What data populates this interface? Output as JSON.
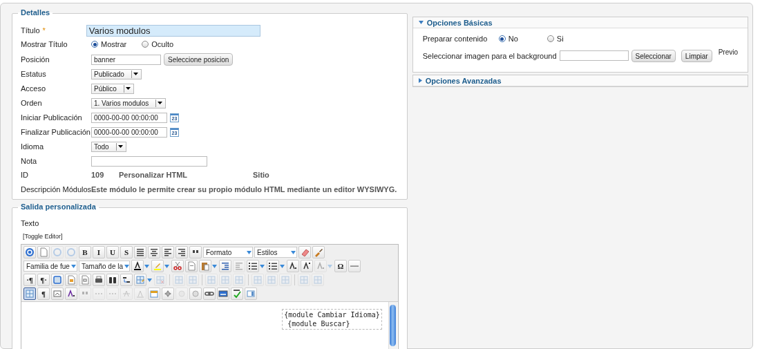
{
  "details": {
    "legend": "Detalles",
    "fields": [
      {
        "kind": "title",
        "label": "Título",
        "required_mark": "*",
        "value": "Varios modulos",
        "focused": true
      },
      {
        "kind": "radio",
        "label": "Mostrar Título",
        "options": [
          {
            "label": "Mostrar",
            "selected": true
          },
          {
            "label": "Oculto",
            "selected": false
          }
        ]
      },
      {
        "kind": "text",
        "label": "Posición",
        "value": "banner",
        "button": "Seleccione posicion"
      },
      {
        "kind": "select",
        "label": "Estatus",
        "value": "Publicado"
      },
      {
        "kind": "select",
        "label": "Acceso",
        "value": "Público"
      },
      {
        "kind": "select",
        "label": "Orden",
        "value": "1. Varios modulos"
      },
      {
        "kind": "date",
        "label": "Iniciar Publicación",
        "value": "0000-00-00 00:00:00",
        "calendar_day": "23"
      },
      {
        "kind": "date",
        "label": "Finalizar Publicación",
        "value": "0000-00-00 00:00:00",
        "calendar_day": "23"
      },
      {
        "kind": "select",
        "label": "Idioma",
        "value": "Todo"
      },
      {
        "kind": "note",
        "label": "Nota"
      },
      {
        "kind": "info",
        "label": "ID",
        "values": [
          "109",
          "Personalizar HTML",
          "Sitio"
        ]
      },
      {
        "kind": "info",
        "label": "Descripción Módulos",
        "values": [
          "Este módulo le permite crear su propio módulo HTML mediante un editor WYSIWYG."
        ]
      }
    ]
  },
  "panels": [
    {
      "title": "Opciones Básicas",
      "expanded": true,
      "fields": [
        {
          "kind": "radio",
          "label": "Preparar contenido",
          "options": [
            {
              "label": "No",
              "selected": true
            },
            {
              "label": "Si",
              "selected": false
            }
          ]
        },
        {
          "kind": "media",
          "label": "Seleccionar imagen para el background",
          "buttons": [
            "Seleccionar",
            "Limpiar"
          ],
          "preview": "Previo"
        }
      ]
    },
    {
      "title": "Opciones Avanzadas",
      "expanded": false
    }
  ],
  "output": {
    "legend": "Salida personalizada",
    "label": "Texto",
    "toggle": "[Toggle Editor]",
    "toolbar": [
      [
        {
          "kind": "icon",
          "disabled": false
        },
        {
          "kind": "icon",
          "disabled": false
        },
        {
          "kind": "icon",
          "disabled": true
        },
        {
          "kind": "icon",
          "disabled": true
        },
        {
          "kind": "text",
          "label": "B",
          "disabled": false
        },
        {
          "kind": "text",
          "label": "I",
          "disabled": false
        },
        {
          "kind": "text",
          "label": "U",
          "disabled": false
        },
        {
          "kind": "text",
          "label": "S",
          "disabled": false
        },
        {
          "kind": "icon",
          "disabled": false
        },
        {
          "kind": "icon",
          "disabled": false
        },
        {
          "kind": "icon",
          "disabled": false
        },
        {
          "kind": "icon",
          "disabled": false
        },
        {
          "kind": "icon",
          "disabled": false
        },
        {
          "kind": "dropdown",
          "label": "Formato"
        },
        {
          "kind": "dropdown",
          "label": "Estilos"
        },
        {
          "kind": "icon",
          "disabled": false
        },
        {
          "kind": "icon",
          "disabled": false
        }
      ],
      [
        {
          "kind": "dropdown",
          "label": "Familia de fue"
        },
        {
          "kind": "dropdown",
          "label": "Tamaño de la"
        },
        {
          "kind": "split",
          "disabled": false
        },
        {
          "kind": "split",
          "disabled": false
        },
        {
          "kind": "icon",
          "disabled": false
        },
        {
          "kind": "icon",
          "disabled": false
        },
        {
          "kind": "split",
          "disabled": false
        },
        {
          "kind": "icon",
          "disabled": false
        },
        {
          "kind": "icon",
          "disabled": true
        },
        {
          "kind": "split",
          "disabled": false
        },
        {
          "kind": "split",
          "disabled": false
        },
        {
          "kind": "icon",
          "disabled": false
        },
        {
          "kind": "icon",
          "disabled": false
        },
        {
          "kind": "split",
          "disabled": true
        },
        {
          "kind": "text",
          "label": "Ω",
          "disabled": false
        },
        {
          "kind": "icon",
          "disabled": false
        }
      ],
      [
        {
          "kind": "text",
          "label": "·¶",
          "disabled": false
        },
        {
          "kind": "text",
          "label": "¶·",
          "disabled": false
        },
        {
          "kind": "icon",
          "disabled": false
        },
        {
          "kind": "icon",
          "disabled": false
        },
        {
          "kind": "icon",
          "disabled": false
        },
        {
          "kind": "icon",
          "disabled": false
        },
        {
          "kind": "icon",
          "disabled": false
        },
        {
          "kind": "icon",
          "disabled": false
        },
        {
          "kind": "split",
          "disabled": false
        },
        {
          "kind": "icon",
          "disabled": true
        },
        {
          "kind": "separator"
        },
        {
          "kind": "icon",
          "disabled": true
        },
        {
          "kind": "icon",
          "disabled": true
        },
        {
          "kind": "separator"
        },
        {
          "kind": "icon",
          "disabled": true
        },
        {
          "kind": "icon",
          "disabled": true
        },
        {
          "kind": "icon",
          "disabled": true
        },
        {
          "kind": "separator"
        },
        {
          "kind": "icon",
          "disabled": true
        },
        {
          "kind": "icon",
          "disabled": true
        },
        {
          "kind": "icon",
          "disabled": true
        },
        {
          "kind": "separator"
        },
        {
          "kind": "icon",
          "disabled": true
        },
        {
          "kind": "icon",
          "disabled": true
        }
      ],
      [
        {
          "kind": "icon",
          "disabled": false,
          "selected": true
        },
        {
          "kind": "text",
          "label": "¶",
          "disabled": false
        },
        {
          "kind": "icon",
          "disabled": false
        },
        {
          "kind": "icon",
          "disabled": false
        },
        {
          "kind": "icon",
          "disabled": true
        },
        {
          "kind": "icon",
          "disabled": true
        },
        {
          "kind": "icon",
          "disabled": true
        },
        {
          "kind": "icon",
          "disabled": true
        },
        {
          "kind": "icon",
          "disabled": true
        },
        {
          "kind": "icon",
          "disabled": false
        },
        {
          "kind": "icon",
          "disabled": false
        },
        {
          "kind": "icon",
          "disabled": true
        },
        {
          "kind": "icon",
          "disabled": false
        },
        {
          "kind": "icon",
          "disabled": false
        },
        {
          "kind": "icon",
          "disabled": false
        },
        {
          "kind": "icon",
          "disabled": false
        },
        {
          "kind": "icon",
          "disabled": false
        }
      ]
    ],
    "content": [
      "{module Cambiar Idioma}",
      "{module Buscar}"
    ]
  }
}
